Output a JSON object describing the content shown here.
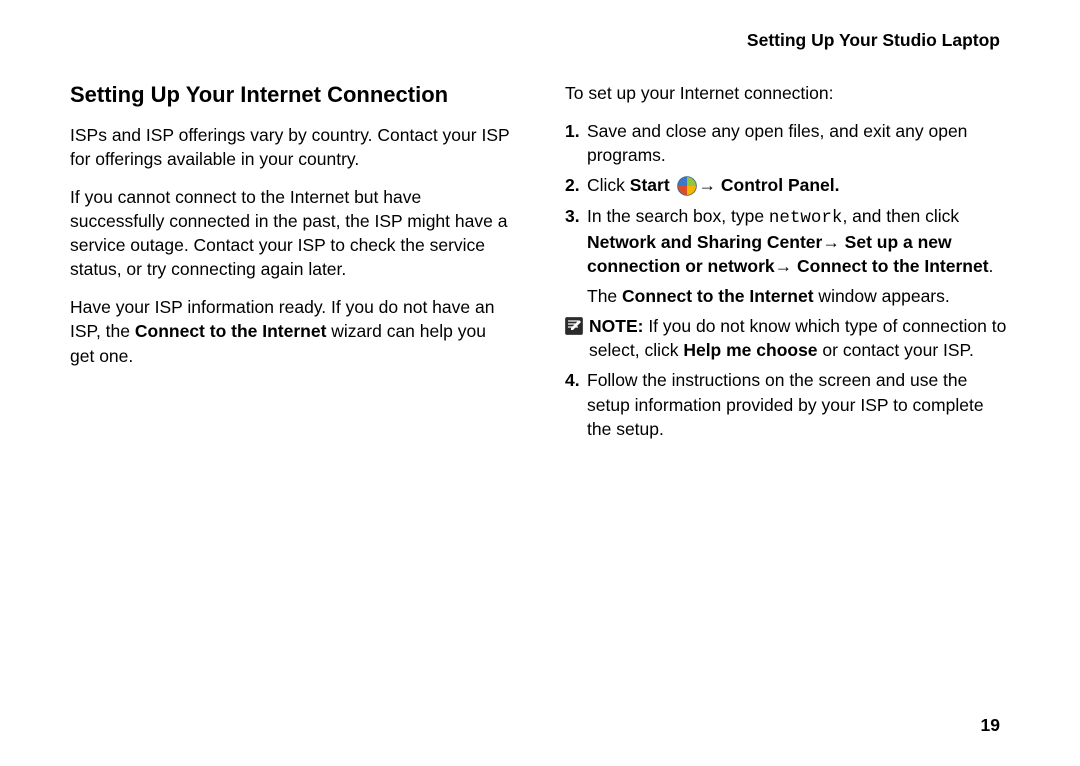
{
  "header": {
    "title": "Setting Up Your Studio Laptop"
  },
  "left": {
    "title": "Setting Up Your Internet Connection",
    "p1": "ISPs and ISP offerings vary by country. Contact your ISP for offerings available in your country.",
    "p2": "If you cannot connect to the Internet but have successfully connected in the past, the ISP might have a service outage. Contact your ISP to check the service status, or try connecting again later.",
    "p3a": "Have your ISP information ready. If you do not have an ISP, the ",
    "p3b": "Connect to the Internet",
    "p3c": " wizard can help you get one."
  },
  "right": {
    "intro": "To set up your Internet connection:",
    "markers": {
      "m1": "1.",
      "m2": "2.",
      "m3": "3.",
      "m4": "4."
    },
    "step1": "Save and close any open files, and exit any open programs.",
    "step2": {
      "a": "Click ",
      "b": "Start ",
      "c": "→ Control Panel."
    },
    "step3": {
      "a": "In the search box, type ",
      "b": "network",
      "c": ", and then click ",
      "d": "Network and Sharing Center→ Set up a new connection or network→ Connect to the Internet",
      "e": "."
    },
    "step3_sub": {
      "a": "The ",
      "b": "Connect to the Internet",
      "c": " window appears."
    },
    "note": {
      "label": "NOTE:",
      "a": " If you do not know which type of connection to select, click ",
      "b": "Help me choose",
      "c": " or contact your ISP."
    },
    "step4": "Follow the instructions on the screen and use the setup information provided by your ISP to complete the setup."
  },
  "pageNumber": "19"
}
